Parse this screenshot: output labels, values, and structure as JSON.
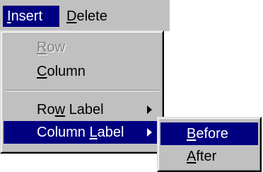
{
  "menubar": {
    "items": [
      {
        "label": "Insert",
        "state": "open"
      },
      {
        "label": "Delete"
      }
    ]
  },
  "insert_menu": {
    "items": [
      {
        "label": "Row",
        "disabled": true
      },
      {
        "label": "Column"
      },
      {
        "label": "Row Label",
        "submenu_icon": "chevron-right-icon"
      },
      {
        "label": "Column Label",
        "submenu_icon": "chevron-right-icon",
        "state": "highlighted"
      }
    ]
  },
  "column_label_submenu": {
    "items": [
      {
        "label": "Before",
        "state": "highlighted"
      },
      {
        "label": "After"
      }
    ]
  },
  "colors": {
    "menu_face": "#c0c0c0",
    "highlight": "#000080",
    "disabled_text": "#808080"
  }
}
